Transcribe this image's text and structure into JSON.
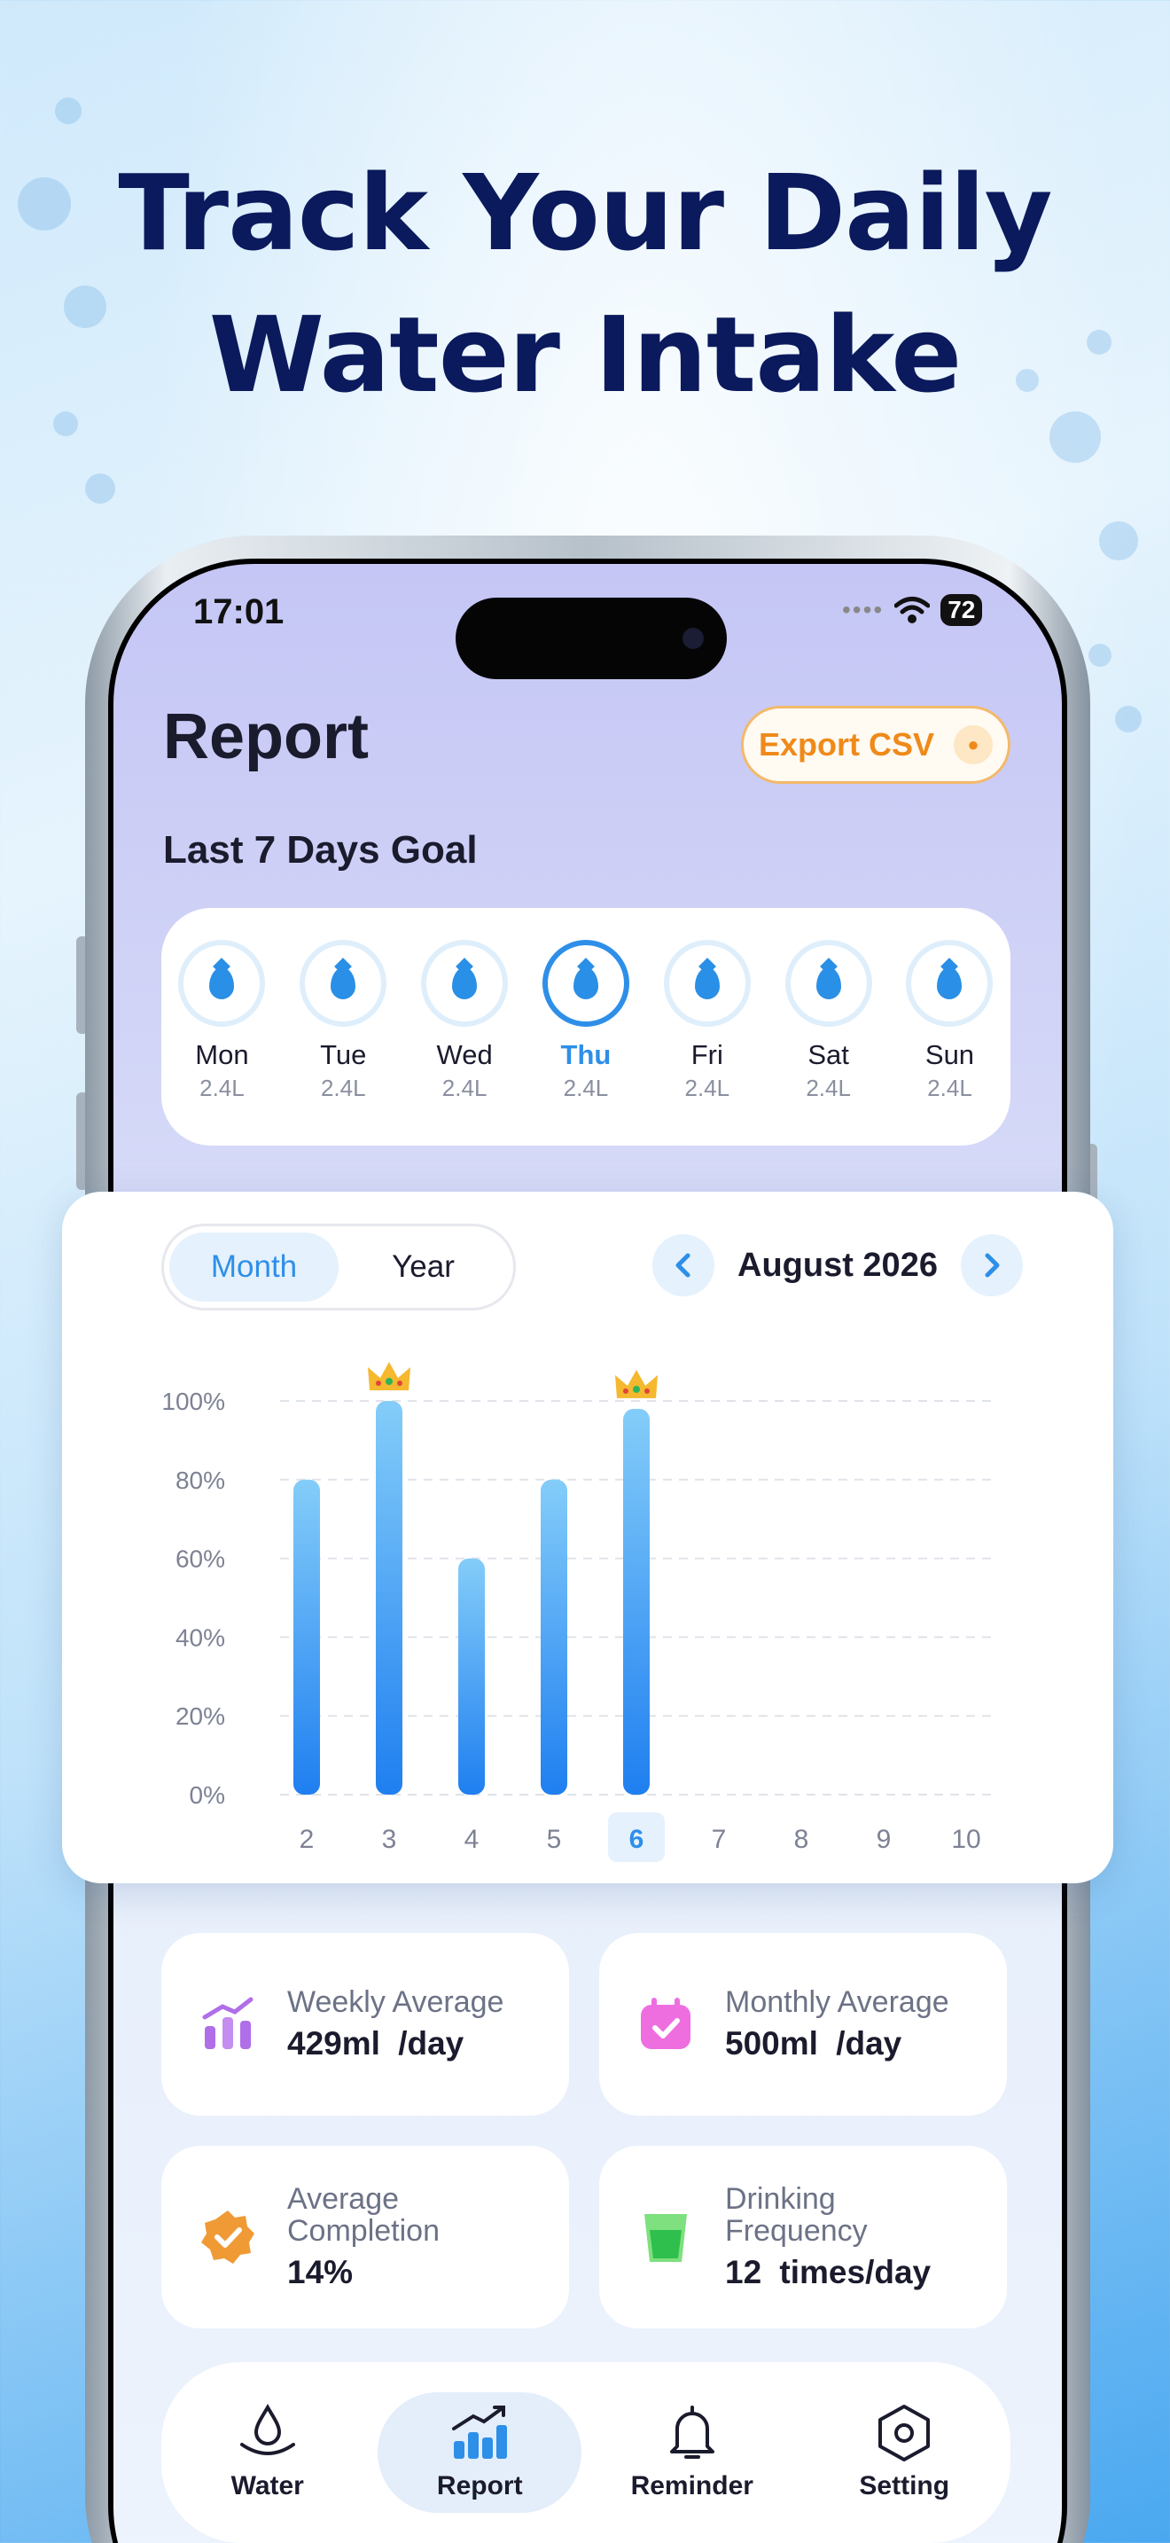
{
  "headline": {
    "line1": "Track Your Daily",
    "line2": "Water Intake"
  },
  "status_bar": {
    "time": "17:01",
    "battery": "72"
  },
  "header": {
    "title": "Report",
    "export_label": "Export CSV"
  },
  "goal": {
    "title": "Last 7 Days Goal",
    "days": [
      {
        "name": "Mon",
        "value": "2.4L"
      },
      {
        "name": "Tue",
        "value": "2.4L"
      },
      {
        "name": "Wed",
        "value": "2.4L"
      },
      {
        "name": "Thu",
        "value": "2.4L",
        "active": true
      },
      {
        "name": "Fri",
        "value": "2.4L"
      },
      {
        "name": "Sat",
        "value": "2.4L"
      },
      {
        "name": "Sun",
        "value": "2.4L"
      }
    ]
  },
  "chart_controls": {
    "tab_month": "Month",
    "tab_year": "Year",
    "selected_tab": "Month",
    "period": "August 2026"
  },
  "chart_data": {
    "type": "bar",
    "categories": [
      "2",
      "3",
      "4",
      "5",
      "6",
      "7",
      "8",
      "9",
      "10"
    ],
    "values": [
      80,
      100,
      60,
      80,
      98,
      0,
      0,
      0,
      0
    ],
    "crowned": [
      "3",
      "6"
    ],
    "highlighted_category": "6",
    "yticks": [
      "0%",
      "20%",
      "40%",
      "60%",
      "80%",
      "100%"
    ],
    "ylim": [
      0,
      100
    ],
    "grid": true,
    "bar_gradient": [
      "#84cdf9",
      "#1f7ff0"
    ]
  },
  "stats": {
    "weekly": {
      "label": "Weekly Average",
      "value": "429ml  /day"
    },
    "monthly": {
      "label": "Monthly Average",
      "value": "500ml  /day"
    },
    "completion": {
      "label1": "Average",
      "label2": "Completion",
      "value": "14%"
    },
    "frequency": {
      "label1": "Drinking",
      "label2": "Frequency",
      "value": "12  times/day"
    }
  },
  "tabs": [
    {
      "label": "Water",
      "icon": "water-drop-icon"
    },
    {
      "label": "Report",
      "icon": "report-chart-icon",
      "active": true
    },
    {
      "label": "Reminder",
      "icon": "bell-icon"
    },
    {
      "label": "Setting",
      "icon": "settings-hex-icon"
    }
  ],
  "colors": {
    "accent": "#2e8fe8",
    "headline": "#0b1a5c",
    "export": "#ef8a1a"
  }
}
